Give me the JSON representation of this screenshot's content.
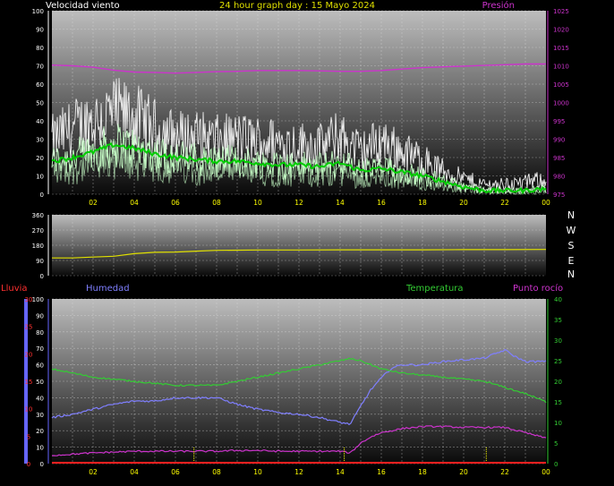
{
  "header": {
    "wind_title": "Velocidad viento",
    "graph_title": "24 hour graph day : 15 Mayo 2024",
    "pressure_title": "Presión"
  },
  "labels": {
    "rain": "Lluvia",
    "humidity": "Humedad",
    "temperature": "Temperatura",
    "dewpoint": "Punto rocío",
    "compass": [
      "N",
      "W",
      "S",
      "E",
      "N"
    ]
  },
  "colors": {
    "wind_gust": "#f0f0f0",
    "wind_speed": "#c8ffc8",
    "wind_avg": "#00cc00",
    "pressure": "#cc33cc",
    "direction": "#e0e000",
    "humidity": "#7f7fff",
    "temperature": "#33cc33",
    "dewpoint": "#cc33cc",
    "rain": "#ff2020",
    "rain_axis": "#6666ff",
    "temp_axis": "#33cc33",
    "dew_axis": "#ff3030",
    "x_tick": "#ffff00",
    "y_tick_left": "#ffffff"
  },
  "chart_data": [
    {
      "id": "wind",
      "type": "line",
      "x_ticks": [
        "02",
        "04",
        "06",
        "08",
        "10",
        "12",
        "14",
        "16",
        "18",
        "20",
        "22",
        "00"
      ],
      "xlim": [
        0,
        24
      ],
      "ylim": [
        0,
        100
      ],
      "y_ticks": [
        "0",
        "10",
        "20",
        "30",
        "40",
        "50",
        "60",
        "70",
        "80",
        "90",
        "100"
      ],
      "y2lim": [
        975,
        1025
      ],
      "y2_ticks": [
        "975",
        "980",
        "985",
        "990",
        "995",
        "1000",
        "1005",
        "1010",
        "1015",
        "1020",
        "1025"
      ],
      "series": [
        {
          "key": "gust",
          "x": [
            0,
            1,
            2,
            3,
            4,
            5,
            6,
            7,
            8,
            9,
            10,
            11,
            12,
            13,
            14,
            15,
            16,
            17,
            18,
            19,
            20,
            21,
            22,
            23,
            24
          ],
          "y": [
            28,
            34,
            38,
            42,
            40,
            34,
            30,
            30,
            28,
            29,
            28,
            27,
            26,
            25,
            30,
            22,
            28,
            22,
            18,
            12,
            8,
            5,
            5,
            6,
            8
          ]
        },
        {
          "key": "avg",
          "x": [
            0,
            1,
            2,
            3,
            4,
            5,
            6,
            7,
            8,
            9,
            10,
            11,
            12,
            13,
            14,
            15,
            16,
            17,
            18,
            19,
            20,
            21,
            22,
            23,
            24
          ],
          "y": [
            18,
            20,
            23,
            27,
            25,
            22,
            20,
            19,
            18,
            18,
            17,
            16,
            16,
            15,
            17,
            13,
            14,
            12,
            10,
            7,
            4,
            2,
            2,
            2,
            3
          ]
        },
        {
          "key": "pressure",
          "x": [
            0,
            1,
            2,
            3,
            4,
            5,
            6,
            7,
            8,
            9,
            10,
            11,
            12,
            13,
            14,
            15,
            16,
            17,
            18,
            19,
            20,
            21,
            22,
            23,
            24
          ],
          "y": [
            1010.2,
            1010.0,
            1009.6,
            1008.8,
            1008.3,
            1008.2,
            1008.0,
            1008.2,
            1008.4,
            1008.5,
            1008.7,
            1008.7,
            1008.7,
            1008.6,
            1008.5,
            1008.5,
            1008.7,
            1009.1,
            1009.5,
            1009.7,
            1009.9,
            1010.1,
            1010.3,
            1010.5,
            1010.5
          ]
        }
      ]
    },
    {
      "id": "direction",
      "type": "line",
      "xlim": [
        0,
        24
      ],
      "ylim": [
        0,
        360
      ],
      "y_ticks": [
        "0",
        "90",
        "180",
        "270",
        "360"
      ],
      "series": [
        {
          "key": "direction",
          "x": [
            0,
            1,
            2,
            3,
            4,
            5,
            6,
            7,
            8,
            10,
            12,
            14,
            16,
            18,
            20,
            22,
            24
          ],
          "y": [
            105,
            105,
            110,
            115,
            130,
            138,
            140,
            145,
            150,
            152,
            152,
            153,
            153,
            153,
            154,
            154,
            155
          ]
        }
      ]
    },
    {
      "id": "humidity_temp",
      "type": "line",
      "x_ticks": [
        "02",
        "04",
        "06",
        "08",
        "10",
        "12",
        "14",
        "16",
        "18",
        "20",
        "22",
        "00"
      ],
      "xlim": [
        0,
        24
      ],
      "ylim": [
        0,
        100
      ],
      "y_ticks": [
        "0",
        "10",
        "20",
        "30",
        "40",
        "50",
        "60",
        "70",
        "80",
        "90",
        "100"
      ],
      "rain_ylim": [
        0,
        30
      ],
      "rain_ticks": [
        "0",
        "5",
        "10",
        "15",
        "20",
        "25",
        "30"
      ],
      "temp_ylim": [
        0,
        40
      ],
      "temp_ticks": [
        "0",
        "5",
        "10",
        "15",
        "20",
        "25",
        "30",
        "35",
        "40"
      ],
      "series": [
        {
          "key": "humidity",
          "x": [
            0,
            1,
            2,
            3,
            4,
            5,
            6,
            7,
            8,
            9,
            10,
            11,
            12,
            13,
            14,
            14.5,
            15,
            15.5,
            16,
            16.5,
            17,
            18,
            19,
            20,
            21,
            22,
            22.5,
            23,
            24
          ],
          "y": [
            28,
            30,
            33,
            36,
            38,
            38,
            40,
            40,
            40,
            36,
            33,
            31,
            30,
            28,
            25,
            24,
            35,
            45,
            52,
            58,
            60,
            60,
            62,
            63,
            64,
            69,
            65,
            62,
            62
          ]
        },
        {
          "key": "temperature",
          "x": [
            0,
            1,
            2,
            3,
            4,
            5,
            6,
            7,
            8,
            9,
            10,
            11,
            12,
            13,
            14,
            14.5,
            15,
            16,
            17,
            18,
            19,
            20,
            21,
            22,
            23,
            24
          ],
          "y": [
            23,
            22,
            21,
            20.5,
            20,
            19.5,
            19,
            19,
            19,
            20,
            21,
            22,
            23,
            24,
            25,
            25.5,
            25,
            23,
            22,
            21.5,
            21,
            20.5,
            20,
            18.5,
            17,
            15
          ]
        },
        {
          "key": "dewpoint",
          "x": [
            0,
            1,
            2,
            3,
            4,
            5,
            6,
            7,
            8,
            9,
            10,
            11,
            12,
            13,
            14,
            14.5,
            15,
            15.5,
            16,
            17,
            18,
            19,
            20,
            21,
            22,
            23,
            24
          ],
          "y": [
            2,
            2.3,
            2.6,
            2.8,
            3,
            3,
            3,
            3,
            3,
            3.2,
            3.2,
            3,
            3,
            3,
            3,
            2.6,
            5,
            6.5,
            7.5,
            8.5,
            9,
            9,
            8.8,
            8.8,
            8.8,
            7.5,
            6.2
          ]
        },
        {
          "key": "rain",
          "x": [
            0,
            24
          ],
          "y": [
            0,
            0
          ]
        }
      ],
      "markers": [
        6.9,
        14.2,
        21.1
      ]
    }
  ]
}
